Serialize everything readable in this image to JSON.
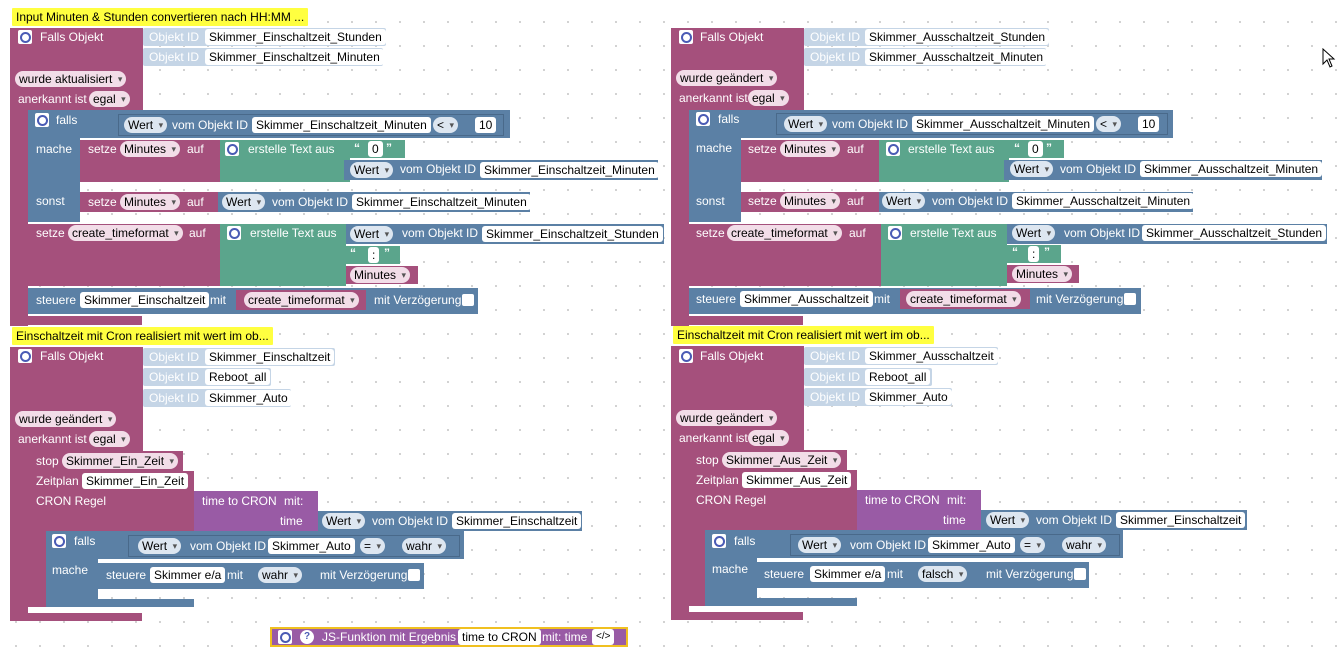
{
  "left": {
    "comment": "Input Minuten & Stunden convertieren nach HH:MM ...",
    "trigger": {
      "label": "Falls Objekt",
      "objid": "Objekt ID",
      "ids": [
        "Skimmer_Einschaltzeit_Stunden",
        "Skimmer_Einschaltzeit_Minuten"
      ],
      "event": "wurde aktualisiert",
      "ack_label": "anerkannt ist",
      "ack": "egal"
    },
    "if": {
      "label": "falls",
      "wert": "Wert",
      "vom": "vom Objekt ID",
      "id": "Skimmer_Einschaltzeit_Minuten",
      "op": "<",
      "num": "10",
      "mache": "mache",
      "sonst": "sonst"
    },
    "set1": {
      "setze": "setze",
      "var": "Minutes",
      "auf": "auf",
      "text": "erstelle Text aus",
      "lit": "0",
      "wert": "Wert",
      "vom": "vom Objekt ID",
      "id": "Skimmer_Einschaltzeit_Minuten"
    },
    "set2": {
      "setze": "setze",
      "var": "Minutes",
      "auf": "auf",
      "wert": "Wert",
      "vom": "vom Objekt ID",
      "id": "Skimmer_Einschaltzeit_Minuten"
    },
    "set3": {
      "setze": "setze",
      "var": "create_timeformat",
      "auf": "auf",
      "text": "erstelle Text aus",
      "wert": "Wert",
      "vom": "vom Objekt ID",
      "id": "Skimmer_Einschaltzeit_Stunden",
      "lit": ":",
      "var2": "Minutes"
    },
    "ctrl": {
      "steuere": "steuere",
      "id": "Skimmer_Einschaltzeit",
      "mit": "mit",
      "var": "create_timeformat",
      "delay": "mit Verzögerung"
    },
    "comment2": "Einschaltzeit mit Cron realisiert mit wert im ob...",
    "trigger2": {
      "label": "Falls Objekt",
      "objid": "Objekt ID",
      "ids": [
        "Skimmer_Einschaltzeit",
        "Reboot_all",
        "Skimmer_Auto"
      ],
      "event": "wurde geändert",
      "ack_label": "anerkannt ist",
      "ack": "egal"
    },
    "stop": {
      "label": "stop",
      "var": "Skimmer_Ein_Zeit"
    },
    "plan": {
      "label": "Zeitplan",
      "var": "Skimmer_Ein_Zeit",
      "cron": "CRON Regel"
    },
    "fn": {
      "name": "time to CRON",
      "mit": "mit:",
      "time": "time",
      "wert": "Wert",
      "vom": "vom Objekt ID",
      "id": "Skimmer_Einschaltzeit"
    },
    "if2": {
      "label": "falls",
      "wert": "Wert",
      "vom": "vom Objekt ID",
      "id": "Skimmer_Auto",
      "op": "=",
      "val": "wahr",
      "mache": "mache"
    },
    "ctrl2": {
      "steuere": "steuere",
      "id": "Skimmer e/a",
      "mit": "mit",
      "val": "wahr",
      "delay": "mit Verzögerung"
    }
  },
  "right": {
    "trigger": {
      "label": "Falls Objekt",
      "objid": "Objekt ID",
      "ids": [
        "Skimmer_Ausschaltzeit_Stunden",
        "Skimmer_Ausschaltzeit_Minuten"
      ],
      "event": "wurde geändert",
      "ack_label": "anerkannt ist",
      "ack": "egal"
    },
    "if": {
      "label": "falls",
      "wert": "Wert",
      "vom": "vom Objekt ID",
      "id": "Skimmer_Ausschaltzeit_Minuten",
      "op": "<",
      "num": "10",
      "mache": "mache",
      "sonst": "sonst"
    },
    "set1": {
      "setze": "setze",
      "var": "Minutes",
      "auf": "auf",
      "text": "erstelle Text aus",
      "lit": "0",
      "wert": "Wert",
      "vom": "vom Objekt ID",
      "id": "Skimmer_Ausschaltzeit_Minuten"
    },
    "set2": {
      "setze": "setze",
      "var": "Minutes",
      "auf": "auf",
      "wert": "Wert",
      "vom": "vom Objekt ID",
      "id": "Skimmer_Ausschaltzeit_Minuten"
    },
    "set3": {
      "setze": "setze",
      "var": "create_timeformat",
      "auf": "auf",
      "text": "erstelle Text aus",
      "wert": "Wert",
      "vom": "vom Objekt ID",
      "id": "Skimmer_Ausschaltzeit_Stunden",
      "lit": ":",
      "var2": "Minutes"
    },
    "ctrl": {
      "steuere": "steuere",
      "id": "Skimmer_Ausschaltzeit",
      "mit": "mit",
      "var": "create_timeformat",
      "delay": "mit Verzögerung"
    },
    "comment2": "Einschaltzeit mit Cron realisiert mit wert im ob...",
    "trigger2": {
      "label": "Falls Objekt",
      "objid": "Objekt ID",
      "ids": [
        "Skimmer_Ausschaltzeit",
        "Reboot_all",
        "Skimmer_Auto"
      ],
      "event": "wurde geändert",
      "ack_label": "anerkannt ist",
      "ack": "egal"
    },
    "stop": {
      "label": "stop",
      "var": "Skimmer_Aus_Zeit"
    },
    "plan": {
      "label": "Zeitplan",
      "var": "Skimmer_Aus_Zeit",
      "cron": "CRON Regel"
    },
    "fn": {
      "name": "time to CRON",
      "mit": "mit:",
      "time": "time",
      "wert": "Wert",
      "vom": "vom Objekt ID",
      "id": "Skimmer_Einschaltzeit"
    },
    "if2": {
      "label": "falls",
      "wert": "Wert",
      "vom": "vom Objekt ID",
      "id": "Skimmer_Auto",
      "op": "=",
      "val": "wahr",
      "mache": "mache"
    },
    "ctrl2": {
      "steuere": "steuere",
      "id": "Skimmer e/a",
      "mit": "mit",
      "val": "falsch",
      "delay": "mit Verzögerung"
    }
  },
  "jsfn": {
    "label": "JS-Funktion mit Ergebnis",
    "name": "time to CRON",
    "mit": "mit: time",
    "code": "</>"
  },
  "icons": {
    "gear": "gear-icon",
    "help": "help-icon",
    "cursor": "mouse-cursor-icon"
  }
}
